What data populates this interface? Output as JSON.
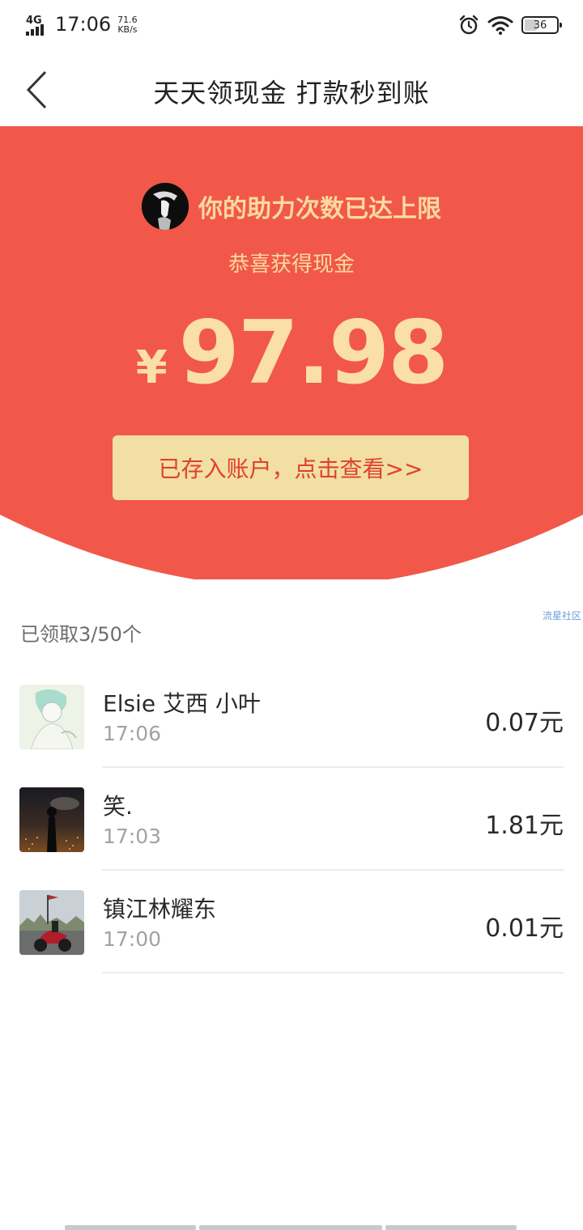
{
  "status_bar": {
    "network": "4G",
    "time": "17:06",
    "speed_value": "71.6",
    "speed_unit": "KB/s",
    "battery": "36",
    "icons": [
      "alarm-icon",
      "wifi-icon",
      "battery-icon"
    ]
  },
  "nav": {
    "title": "天天领现金 打款秒到账",
    "back_icon": "chevron-left-icon"
  },
  "banner": {
    "limit_text": "你的助力次数已达上限",
    "congrats": "恭喜获得现金",
    "currency": "¥",
    "amount": "97.98",
    "button_label": "已存入账户，点击查看>>",
    "colors": {
      "background": "#f15849",
      "gold_text": "#fbd9a0",
      "button_bg": "#f2dfa4",
      "button_text": "#e0412c"
    }
  },
  "watermark": "流星社区",
  "claimed_text": "已领取3/50个",
  "list": [
    {
      "name": "Elsie 艾西 小叶",
      "time": "17:06",
      "amount": "0.07元"
    },
    {
      "name": "笑.",
      "time": "17:03",
      "amount": "1.81元"
    },
    {
      "name": "镇江林耀东",
      "time": "17:00",
      "amount": "0.01元"
    }
  ]
}
